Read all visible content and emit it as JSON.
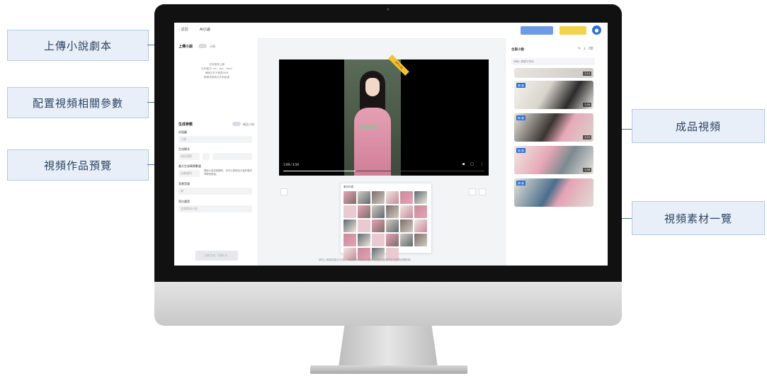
{
  "callouts": {
    "upload": "上傳小說劇本",
    "config": "配置視頻相關參數",
    "preview": "視頻作品預覽",
    "product": "成品視頻",
    "material": "視頻素材一覽"
  },
  "colors": {
    "accent": "#2f6fd6",
    "callout_bg": "#e8eff8",
    "leader_line": "#4a72a8",
    "warning_button": "#f3d34a"
  },
  "app": {
    "topbar": {
      "back": "‹ 返回",
      "title": "AI小說"
    },
    "left": {
      "upload_title": "上傳小說",
      "upload_switch": "示例",
      "upload_hints": "支持拖拽上傳\n文件格式: txt、doc、docx\n單個文件不超過50M\n點擊或拖拽文件到此處",
      "gen_params": "生成參數",
      "gen_switch_label": "精品小說",
      "cover_label": "封面圖",
      "cover_placeholder": "可選",
      "mode_label": "生成模式",
      "mode_value": "按段落節",
      "max_chapters_label": "最大生成章節數量",
      "max_chapters_value": "自動識別",
      "max_chapters_hint": "根據小說自動識別，也可以按照自己喜好更改章節的數量。",
      "bgm_label": "背景音樂",
      "bgm_placeholder": "無",
      "voice_label": "旁白聲音",
      "voice_value": "溫柔解說小姐",
      "generate_button": "立即生成（消耗 0）"
    },
    "player": {
      "ribbon": "熱門小說",
      "time": "1:09 / 3:19",
      "progress": 0.36
    },
    "material": {
      "title": "素材列表",
      "thumb_count": 28
    },
    "notice": "請勿上傳違規違法內容，平台將對內容進行審核，如發現違規將依法處理相關賬號。",
    "right": {
      "title": "全部小說",
      "search_placeholder": "請輸入關鍵字搜索",
      "cards": [
        {
          "tag": "",
          "duration": "1:10"
        },
        {
          "tag": "第1集",
          "duration": "1:56"
        },
        {
          "tag": "第1集",
          "duration": "1:22"
        },
        {
          "tag": "第1集",
          "duration": "1:58"
        },
        {
          "tag": "第1集",
          "duration": ""
        }
      ]
    }
  }
}
